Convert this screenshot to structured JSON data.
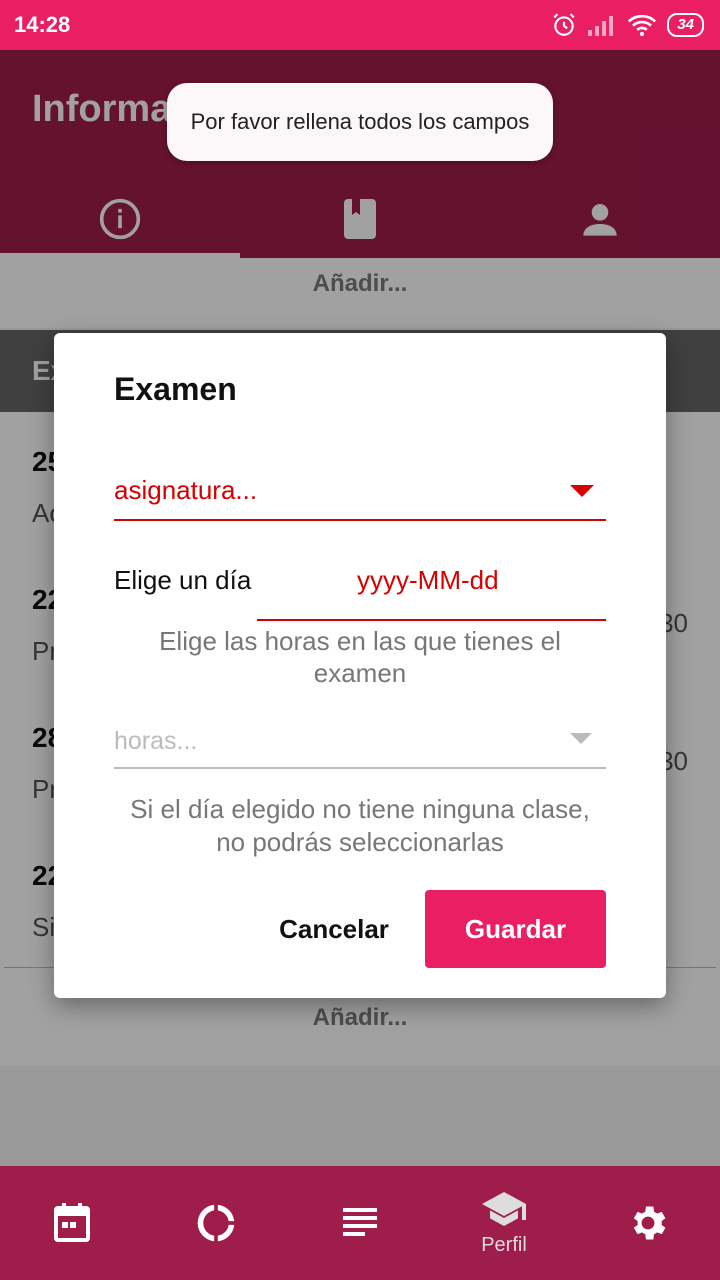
{
  "status_bar": {
    "time": "14:28",
    "battery": "34"
  },
  "app_bar": {
    "title": "Información"
  },
  "tabs": [
    {
      "icon": "info-icon"
    },
    {
      "icon": "book-icon"
    },
    {
      "icon": "person-icon"
    }
  ],
  "content": {
    "add_top": "Añadir...",
    "section_initial": "Ex",
    "items": [
      {
        "title": "25",
        "sub": "Ac",
        "right": ""
      },
      {
        "title": "22",
        "sub": "Pr",
        "right": "30"
      },
      {
        "title": "28",
        "sub": "Pr",
        "right": "30"
      },
      {
        "title": "22",
        "sub": "Si",
        "right": ""
      }
    ],
    "add_bottom": "Añadir..."
  },
  "toast": {
    "text": "Por favor rellena todos los campos"
  },
  "dialog": {
    "title": "Examen",
    "subject_placeholder": "asignatura...",
    "date_label": "Elige un día",
    "date_placeholder": "yyyy-MM-dd",
    "hours_info": "Elige las horas en las que tienes el examen",
    "hours_placeholder": "horas...",
    "day_info": "Si el día elegido no tiene ninguna clase, no podrás seleccionarlas",
    "cancel": "Cancelar",
    "save": "Guardar"
  },
  "bottom_nav": {
    "items": [
      {
        "icon": "calendar-icon"
      },
      {
        "icon": "progress-icon"
      },
      {
        "icon": "list-icon"
      },
      {
        "icon": "graduation-cap-icon",
        "label": "Perfil"
      },
      {
        "icon": "gear-icon"
      }
    ]
  },
  "colors": {
    "primary": "#e91e63",
    "primary_dark": "#9f1d4a",
    "error": "#d50000"
  }
}
